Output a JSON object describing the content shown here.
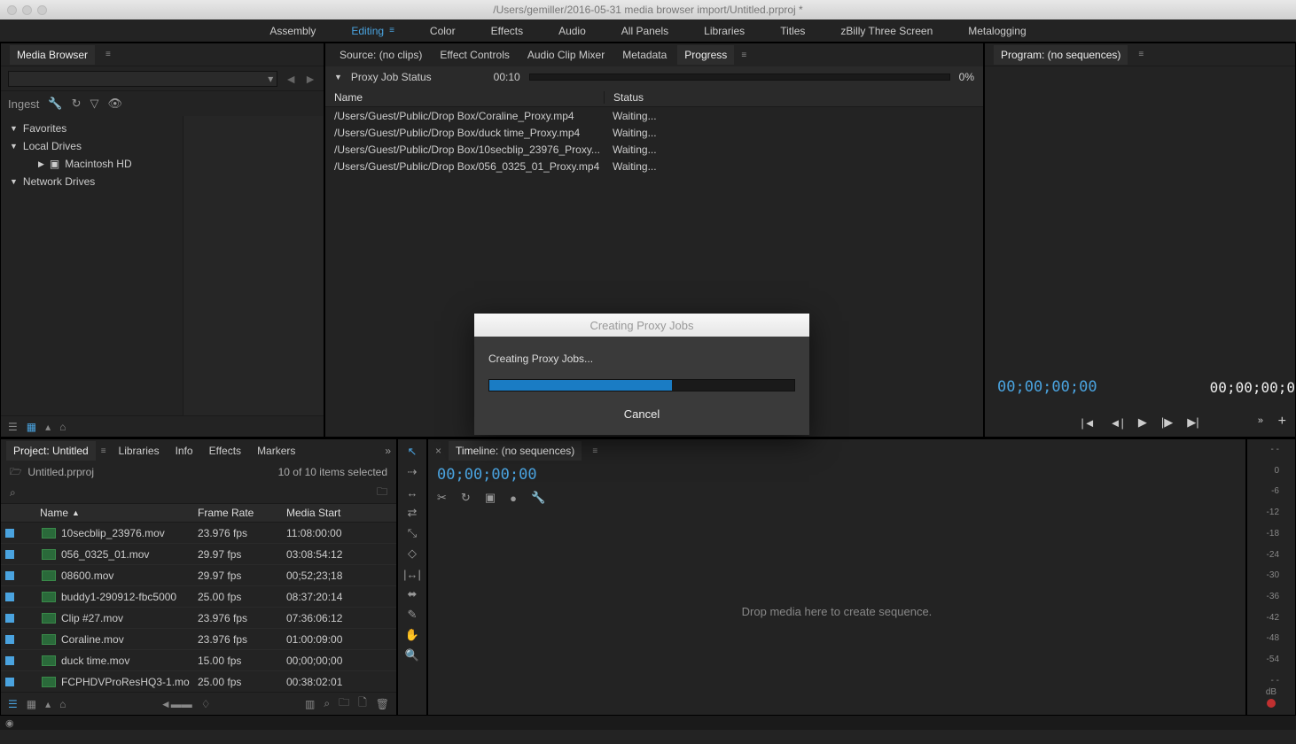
{
  "titlebar": {
    "path": "/Users/gemiller/2016-05-31 media browser import/Untitled.prproj *"
  },
  "workspaces": [
    {
      "label": "Assembly",
      "active": false
    },
    {
      "label": "Editing",
      "active": true,
      "menu": true
    },
    {
      "label": "Color",
      "active": false
    },
    {
      "label": "Effects",
      "active": false
    },
    {
      "label": "Audio",
      "active": false
    },
    {
      "label": "All Panels",
      "active": false
    },
    {
      "label": "Libraries",
      "active": false
    },
    {
      "label": "Titles",
      "active": false
    },
    {
      "label": "zBilly Three Screen",
      "active": false
    },
    {
      "label": "Metalogging",
      "active": false
    }
  ],
  "media_browser": {
    "title": "Media Browser",
    "ingest_label": "Ingest",
    "tree": {
      "favorites": "Favorites",
      "local_drives": "Local Drives",
      "mac_hd": "Macintosh HD",
      "network_drives": "Network Drives"
    }
  },
  "source": {
    "tabs": [
      {
        "label": "Source: (no clips)",
        "active": false
      },
      {
        "label": "Effect Controls",
        "active": false
      },
      {
        "label": "Audio Clip Mixer",
        "active": false
      },
      {
        "label": "Metadata",
        "active": false
      },
      {
        "label": "Progress",
        "active": true,
        "menu": true
      }
    ],
    "progress": {
      "title": "Proxy Job Status",
      "time": "00:10",
      "percent": "0%",
      "name_header": "Name",
      "status_header": "Status",
      "jobs": [
        {
          "name": "/Users/Guest/Public/Drop Box/Coraline_Proxy.mp4",
          "status": "Waiting..."
        },
        {
          "name": "/Users/Guest/Public/Drop Box/duck time_Proxy.mp4",
          "status": "Waiting..."
        },
        {
          "name": "/Users/Guest/Public/Drop Box/10secblip_23976_Proxy...",
          "status": "Waiting..."
        },
        {
          "name": "/Users/Guest/Public/Drop Box/056_0325_01_Proxy.mp4",
          "status": "Waiting..."
        }
      ]
    }
  },
  "program": {
    "title": "Program: (no sequences)",
    "timecode1": "00;00;00;00",
    "timecode2": "00;00;00;0"
  },
  "project": {
    "tabs": [
      "Project: Untitled",
      "Libraries",
      "Info",
      "Effects",
      "Markers"
    ],
    "file": "Untitled.prproj",
    "selection": "10 of 10 items selected",
    "columns": {
      "name": "Name",
      "frame_rate": "Frame Rate",
      "media_start": "Media Start"
    },
    "rows": [
      {
        "name": "10secblip_23976.mov",
        "fr": "23.976 fps",
        "ms": "11:08:00:00"
      },
      {
        "name": "056_0325_01.mov",
        "fr": "29.97 fps",
        "ms": "03:08:54:12"
      },
      {
        "name": "08600.mov",
        "fr": "29.97 fps",
        "ms": "00;52;23;18"
      },
      {
        "name": "buddy1-290912-fbc5000",
        "fr": "25.00 fps",
        "ms": "08:37:20:14"
      },
      {
        "name": "Clip #27.mov",
        "fr": "23.976 fps",
        "ms": "07:36:06:12"
      },
      {
        "name": "Coraline.mov",
        "fr": "23.976 fps",
        "ms": "01:00:09:00"
      },
      {
        "name": "duck time.mov",
        "fr": "15.00 fps",
        "ms": "00;00;00;00"
      },
      {
        "name": "FCPHDVProResHQ3-1.mo",
        "fr": "25.00 fps",
        "ms": "00:38:02:01"
      }
    ]
  },
  "timeline": {
    "title": "Timeline: (no sequences)",
    "timecode": "00;00;00;00",
    "drop_msg": "Drop media here to create sequence."
  },
  "audio": {
    "ticks": [
      "- -",
      "0",
      "-6",
      "-12",
      "-18",
      "-24",
      "-30",
      "-36",
      "-42",
      "-48",
      "-54",
      "- -"
    ],
    "db": "dB"
  },
  "modal": {
    "title": "Creating Proxy Jobs",
    "message": "Creating Proxy Jobs...",
    "cancel": "Cancel"
  }
}
